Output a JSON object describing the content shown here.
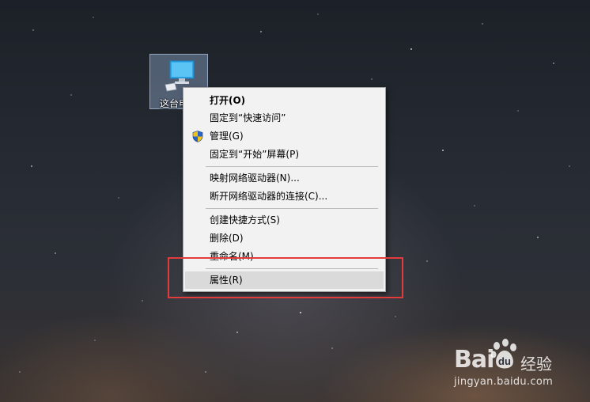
{
  "desktop": {
    "icon_label": "这台电",
    "icon_name": "computer-icon"
  },
  "context_menu": {
    "groups": [
      [
        {
          "label": "打开(O)",
          "bold": true
        },
        {
          "label": "固定到“快速访问”"
        },
        {
          "label": "管理(G)",
          "icon": "uac-shield-icon"
        },
        {
          "label": "固定到“开始”屏幕(P)"
        }
      ],
      [
        {
          "label": "映射网络驱动器(N)..."
        },
        {
          "label": "断开网络驱动器的连接(C)..."
        }
      ],
      [
        {
          "label": "创建快捷方式(S)"
        },
        {
          "label": "删除(D)"
        },
        {
          "label": "重命名(M)"
        }
      ],
      [
        {
          "label": "属性(R)",
          "hovered": true
        }
      ]
    ]
  },
  "annotation": {
    "color": "#e23b3b"
  },
  "watermark": {
    "brand_left": "Bai",
    "brand_right": "经验",
    "url": "jingyan.baidu.com"
  }
}
